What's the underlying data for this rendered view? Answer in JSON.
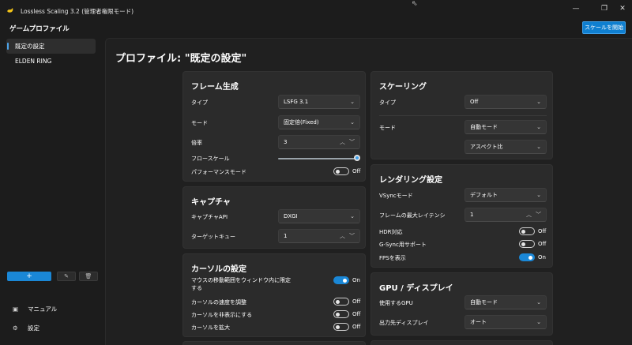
{
  "titlebar": {
    "title": "Lossless Scaling 3.2 (管理者権限モード)",
    "controls": {
      "minimize": "—",
      "maximize": "❐",
      "close": "✕"
    }
  },
  "header": {
    "title": "ゲームプロファイル",
    "scale_button": "スケールを開始"
  },
  "sidebar": {
    "items": [
      {
        "label": "既定の設定",
        "active": true
      },
      {
        "label": "ELDEN RING",
        "active": false
      }
    ],
    "add_label": "+",
    "edit_icon": "✎",
    "delete_icon": "🗑",
    "nav": [
      {
        "label": "マニュアル",
        "icon": "book-icon",
        "glyph": "▣"
      },
      {
        "label": "設定",
        "icon": "gear-icon",
        "glyph": "⚙"
      }
    ]
  },
  "page": {
    "title": "プロファイル: \"既定の設定\""
  },
  "frame_gen": {
    "title": "フレーム生成",
    "type_label": "タイプ",
    "type_value": "LSFG 3.1",
    "mode_label": "モード",
    "mode_value": "固定倍(Fixed)",
    "multiplier_label": "倍率",
    "multiplier_value": "3",
    "flow_scale_label": "フロースケール",
    "flow_scale_fraction": 1.0,
    "perf_mode_label": "パフォーマンスモード",
    "perf_mode_state": "Off"
  },
  "capture": {
    "title": "キャプチャ",
    "api_label": "キャプチャAPI",
    "api_value": "DXGI",
    "queue_label": "ターゲットキュー",
    "queue_value": "1"
  },
  "cursor": {
    "title": "カーソルの設定",
    "clip_label": "マウスの移動範囲をウィンドウ内に限定する",
    "clip_state": "On",
    "speed_label": "カーソルの速度を調整",
    "speed_state": "Off",
    "hide_label": "カーソルを非表示にする",
    "hide_state": "Off",
    "scale_label": "カーソルを拡大",
    "scale_state": "Off"
  },
  "scaling": {
    "title": "スケーリング",
    "type_label": "タイプ",
    "type_value": "Off",
    "mode_label": "モード",
    "mode_value": "自動モード",
    "aspect_value": "アスペクト比"
  },
  "rendering": {
    "title": "レンダリング設定",
    "vsync_label": "VSyncモード",
    "vsync_value": "デフォルト",
    "latency_label": "フレームの最大レイテンシ",
    "latency_value": "1",
    "hdr_label": "HDR対応",
    "hdr_state": "Off",
    "gsync_label": "G-Sync用サポート",
    "gsync_state": "Off",
    "fps_label": "FPSを表示",
    "fps_state": "On"
  },
  "gpu": {
    "title": "GPU / ディスプレイ",
    "gpu_label": "使用するGPU",
    "gpu_value": "自動モード",
    "display_label": "出力先ディスプレイ",
    "display_value": "オート"
  },
  "colors": {
    "accent": "#1a87d6",
    "card": "#2b2b2b",
    "background": "#1c1c1c"
  }
}
